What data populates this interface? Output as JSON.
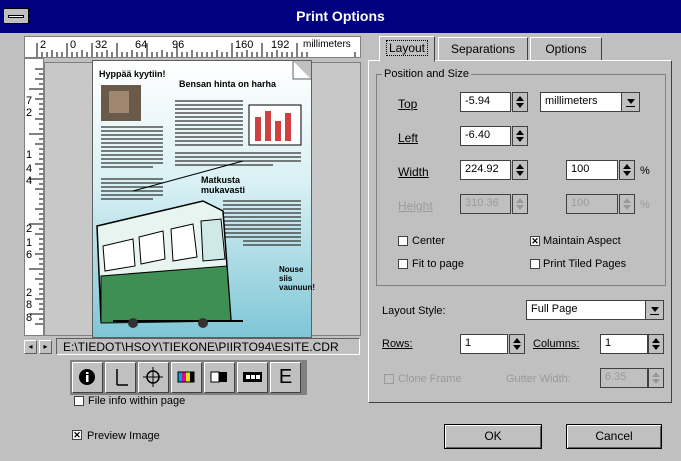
{
  "window": {
    "title": "Print Options"
  },
  "ruler": {
    "units": "millimeters",
    "h_labels": [
      "2",
      "0",
      "32",
      "64",
      "96",
      "160",
      "192"
    ],
    "v_labels": [
      "7",
      "2",
      "1",
      "4",
      "4",
      "2",
      "1",
      "6",
      "2",
      "8",
      "8"
    ]
  },
  "path": {
    "file": "E:\\TIEDOT\\HSOY\\TIEKONE\\PIIRTO94\\ESITE.CDR"
  },
  "preview_page": {
    "heading1": "Hyppää kyytiin!",
    "heading2": "Bensan hinta on harha",
    "heading3": "Matkusta mukavasti",
    "heading4": "Nouse siis vaunuun!"
  },
  "toolbar": {
    "icons": [
      "info-icon",
      "crop-marks-icon",
      "registration-icon",
      "color-bars-icon",
      "densitometer-icon",
      "film-icon",
      "emulsion-icon"
    ],
    "emulsion_label": "E"
  },
  "left_options": {
    "file_info_label": "File info within page",
    "file_info_checked": false,
    "preview_label": "Preview Image",
    "preview_checked": true
  },
  "tabs": [
    {
      "label": "Layout",
      "active": true
    },
    {
      "label": "Separations",
      "active": false
    },
    {
      "label": "Options",
      "active": false
    }
  ],
  "position_size": {
    "group_label": "Position and Size",
    "top_label": "Top",
    "top_value": "-5.94",
    "units_value": "millimeters",
    "left_label": "Left",
    "left_value": "-6.40",
    "width_label": "Width",
    "width_value": "224.92",
    "width_pct": "100",
    "pct_sign": "%",
    "height_label": "Height",
    "height_value": "310.36",
    "height_pct": "100",
    "center_label": "Center",
    "center_checked": false,
    "maintain_label": "Maintain Aspect",
    "maintain_checked": true,
    "fit_label": "Fit to page",
    "fit_checked": false,
    "tiled_label": "Print Tiled Pages",
    "tiled_checked": false
  },
  "layout": {
    "style_label": "Layout Style:",
    "style_value": "Full Page",
    "rows_label": "Rows:",
    "rows_value": "1",
    "columns_label": "Columns:",
    "columns_value": "1",
    "clone_label": "Clone Frame",
    "clone_checked": false,
    "gutter_label": "Gutter Width:",
    "gutter_value": "6.35"
  },
  "buttons": {
    "ok": "OK",
    "cancel": "Cancel"
  }
}
